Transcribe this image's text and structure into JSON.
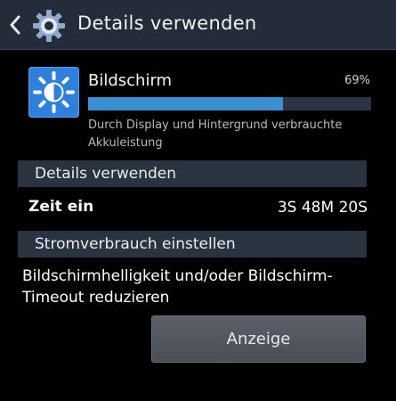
{
  "header": {
    "title": "Details verwenden"
  },
  "usage": {
    "name": "Bildschirm",
    "percent_label": "69%",
    "percent_value": 69,
    "description": "Durch Display und Hintergrund verbrauchte Akkuleistung",
    "icon": "brightness-icon"
  },
  "details_section": {
    "title": "Details verwenden",
    "rows": [
      {
        "label": "Zeit ein",
        "value": "3S 48M 20S"
      }
    ]
  },
  "power_section": {
    "title": "Stromverbrauch einstellen",
    "description": "Bildschirmhelligkeit und/oder Bildschirm-Timeout reduzieren",
    "button_label": "Anzeige"
  },
  "colors": {
    "action_bar": "#232c38",
    "accent": "#3b8fd1",
    "section_header": "#2a3441",
    "icon_bg": "#2f7fdc"
  }
}
